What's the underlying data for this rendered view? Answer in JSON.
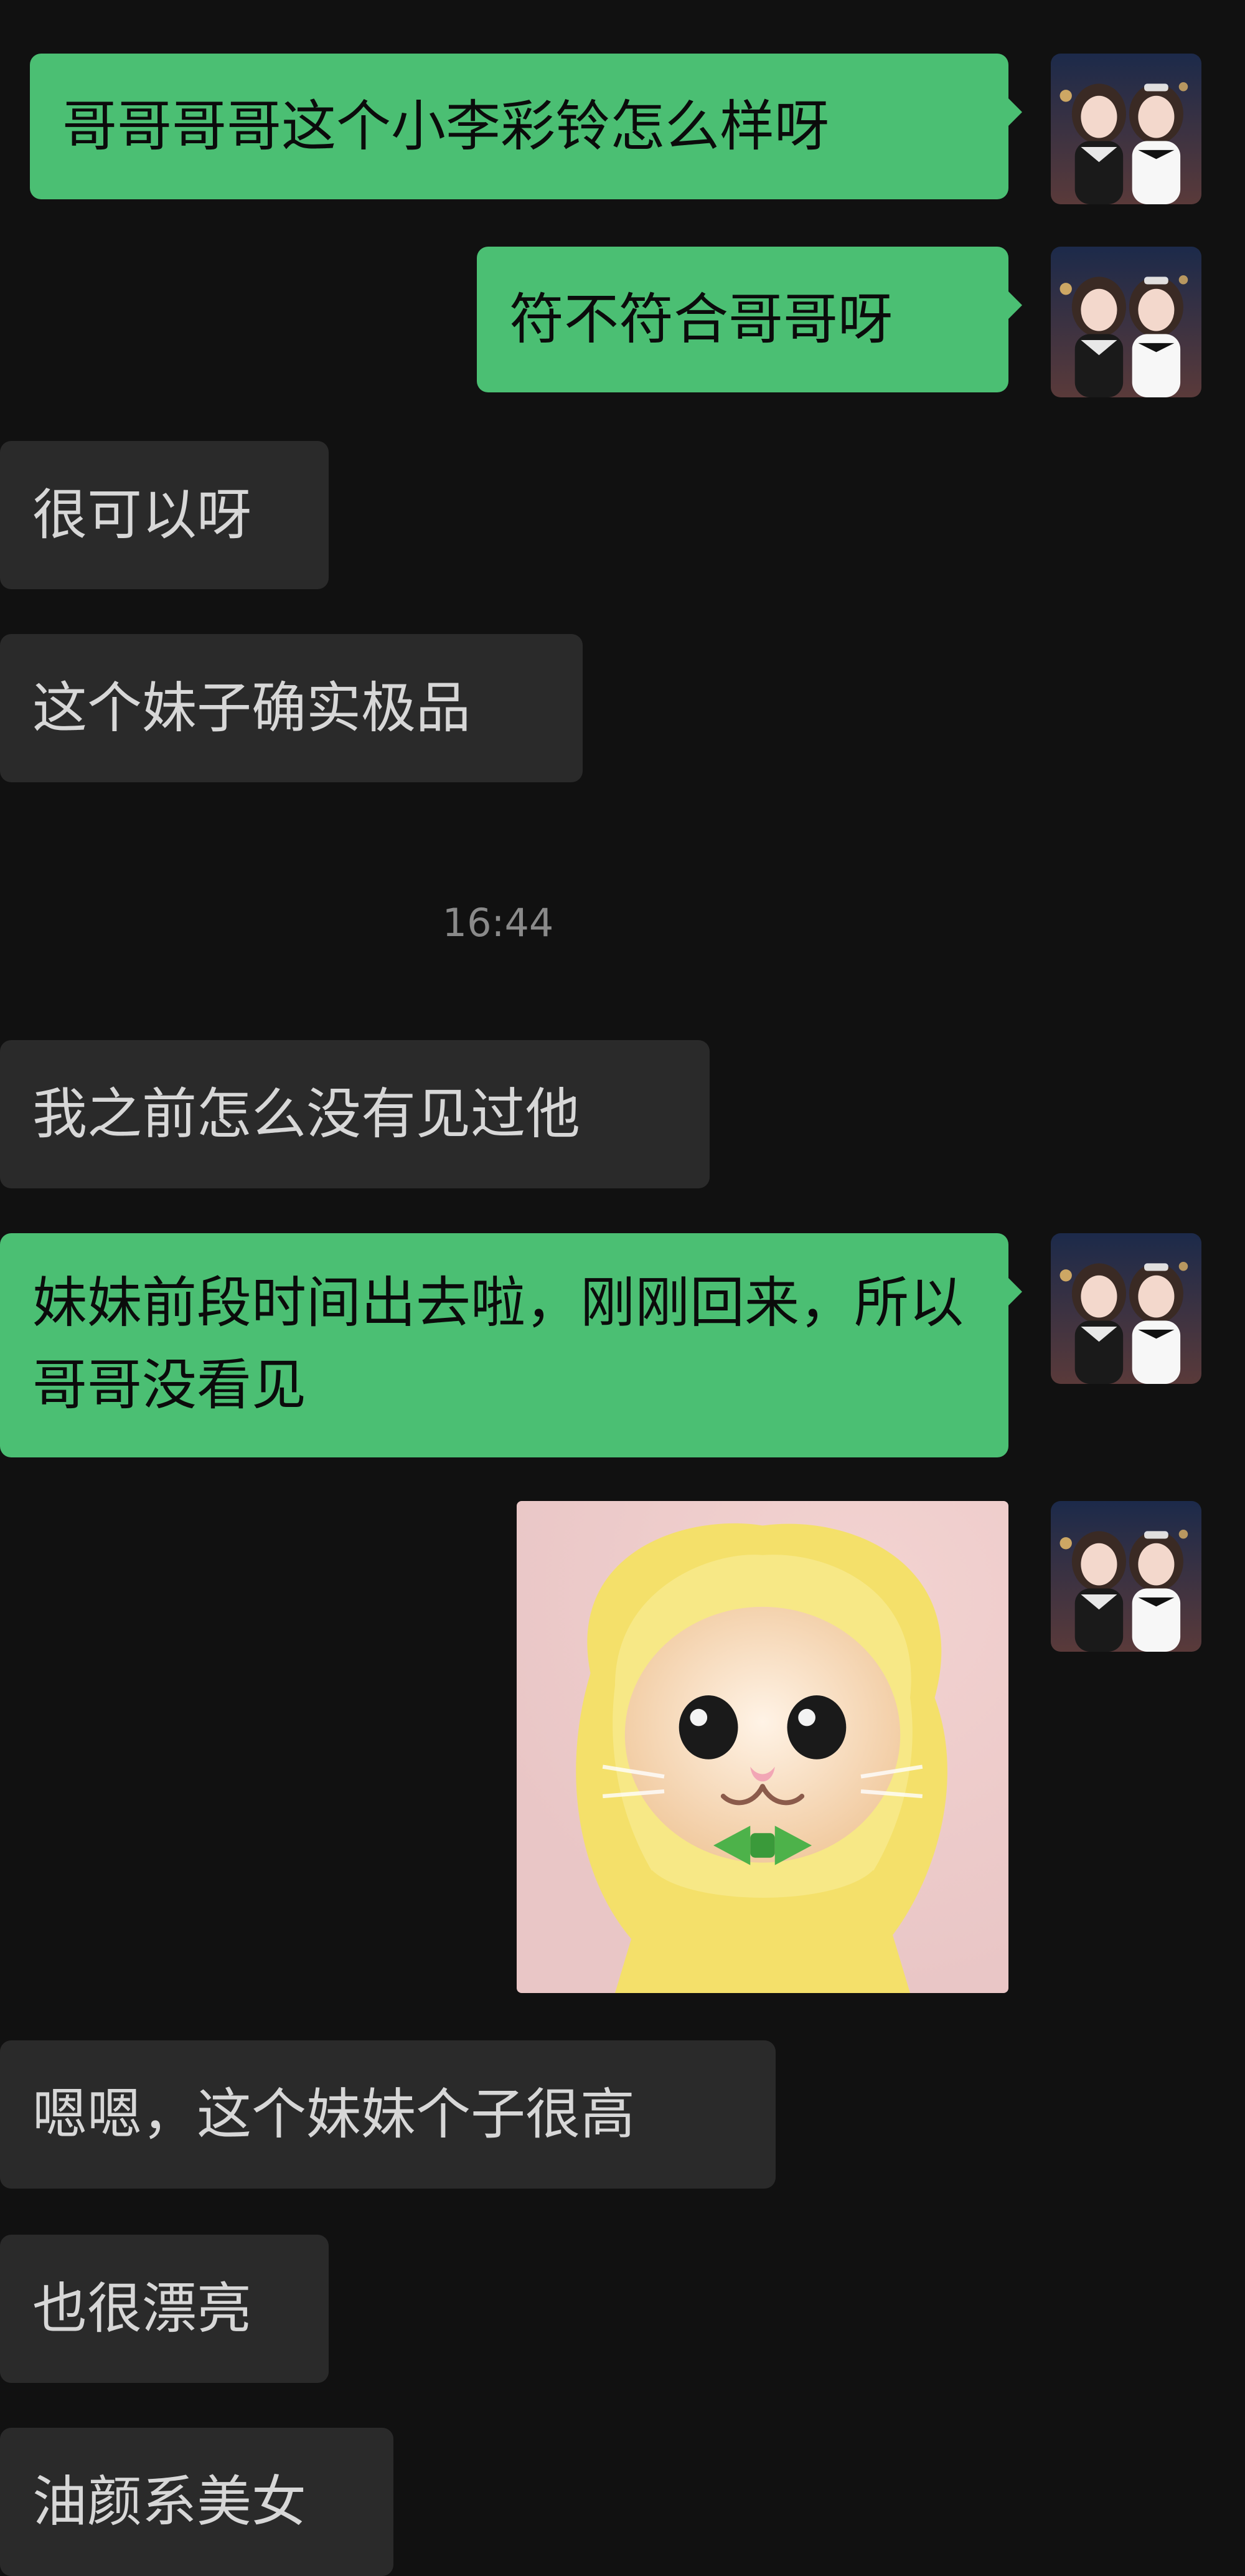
{
  "messages": [
    {
      "text": "哥哥哥哥这个小李彩铃怎么样呀"
    },
    {
      "text": "符不符合哥哥呀"
    },
    {
      "text": "很可以呀"
    },
    {
      "text": "这个妹子确实极品"
    },
    {
      "time": "16:44"
    },
    {
      "text": "我之前怎么没有见过他"
    },
    {
      "text": "妹妹前段时间出去啦，刚刚回来，所以哥哥没看见"
    },
    {
      "image": "cat-banana-hat-photo"
    },
    {
      "text": "嗯嗯，这个妹妹个子很高"
    },
    {
      "text": "也很漂亮"
    },
    {
      "text": "油颜系美女"
    }
  ],
  "colors": {
    "background": "#111111",
    "my_bubble": "#4bbf73",
    "other_bubble": "#2a2a2a",
    "timestamp": "#8a8a8a"
  },
  "icons": {
    "avatar": "twin-girls-avatar"
  }
}
